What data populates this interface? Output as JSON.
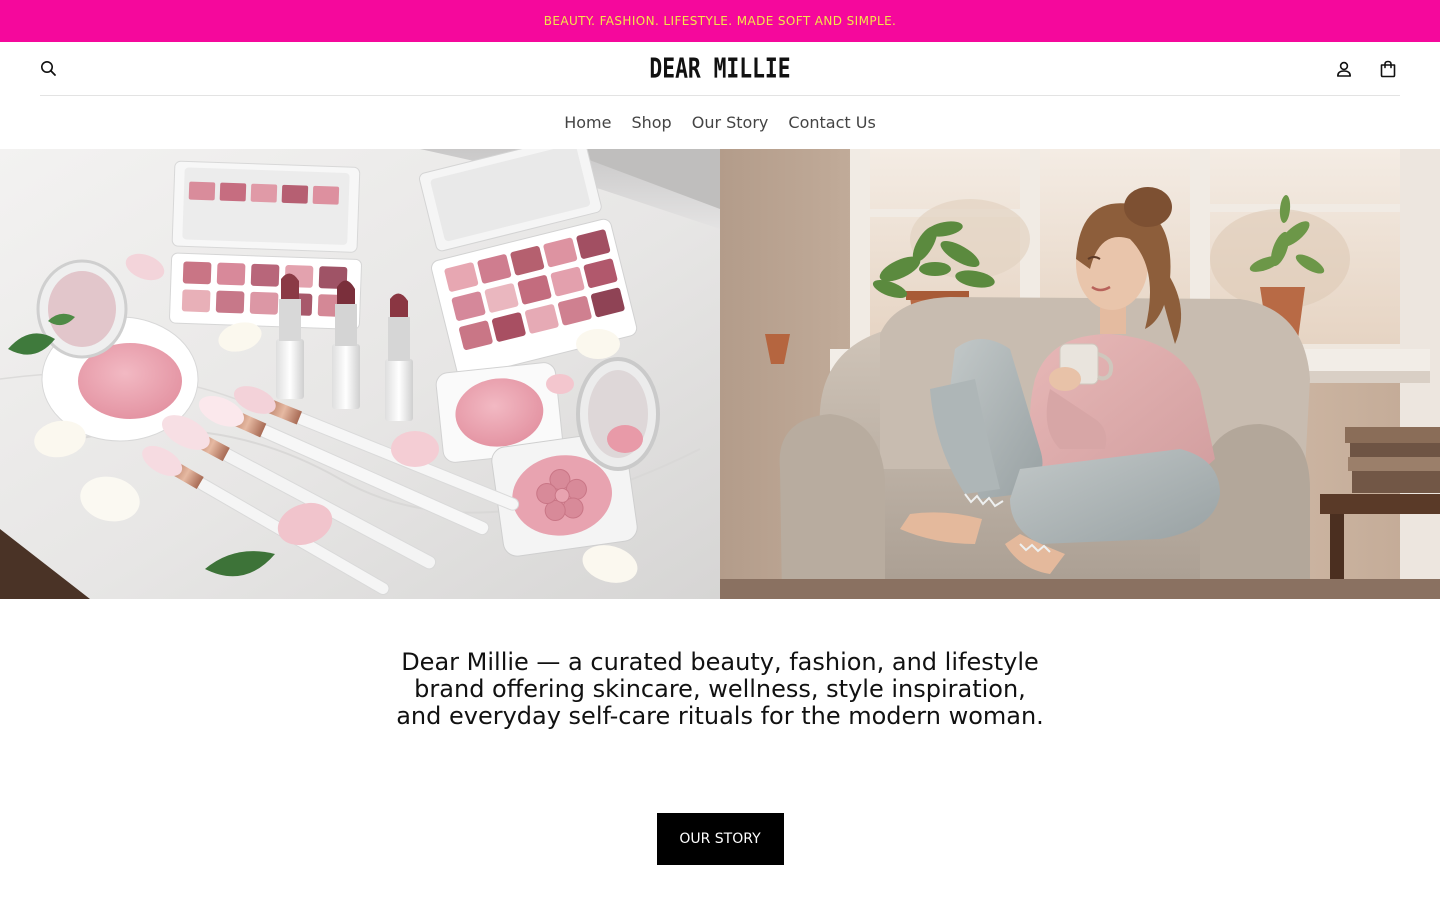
{
  "announcement": {
    "text": "BEAUTY. FASHION. LIFESTYLE. MADE SOFT AND SIMPLE."
  },
  "header": {
    "logo": "DEAR MILLIE",
    "icons": {
      "search": "search-icon",
      "account": "account-icon",
      "cart": "cart-icon"
    }
  },
  "nav": {
    "items": [
      {
        "label": "Home"
      },
      {
        "label": "Shop"
      },
      {
        "label": "Our Story"
      },
      {
        "label": "Contact Us"
      }
    ]
  },
  "hero": {
    "left_image": "makeup-flatlay-image",
    "right_image": "woman-armchair-image"
  },
  "intro": {
    "lines": [
      "Dear Millie — a curated beauty, fashion, and lifestyle",
      "brand offering skincare, wellness, style inspiration,",
      "and everyday self-care rituals for the modern woman."
    ],
    "cta_label": "OUR STORY"
  },
  "colors": {
    "announcement_bg": "#f5089c",
    "announcement_text": "#f3e64a",
    "button_bg": "#000000",
    "button_text": "#ffffff"
  }
}
